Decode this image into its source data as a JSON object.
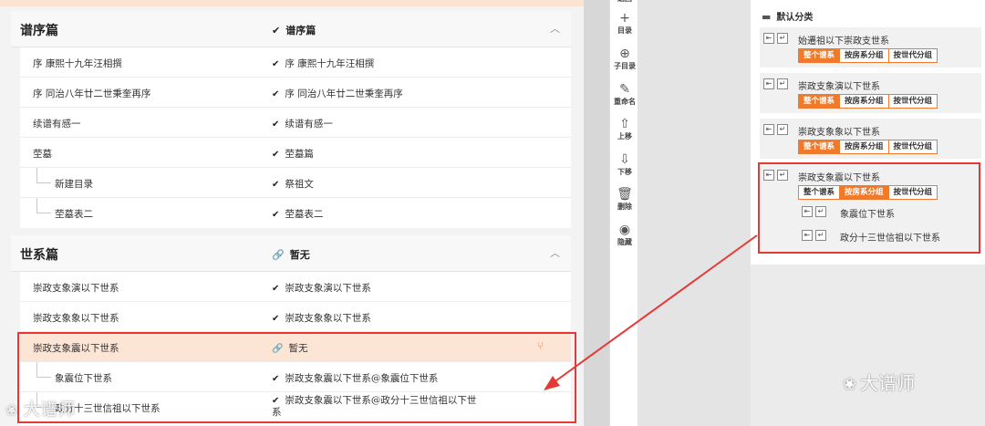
{
  "sections": [
    {
      "title": "谱序篇",
      "link_label": "谱序篇",
      "rows": [
        {
          "name": "序 康熙十九年汪相撰",
          "link": "序 康熙十九年汪相撰",
          "child": false
        },
        {
          "name": "序 同治八年廿二世秉奎再序",
          "link": "序 同治八年廿二世秉奎再序",
          "child": false
        },
        {
          "name": "续谱有感一",
          "link": "续谱有感一",
          "child": false
        },
        {
          "name": "茔墓",
          "link": "茔墓篇",
          "child": false
        },
        {
          "name": "新建目录",
          "link": "祭祖文",
          "child": true
        },
        {
          "name": "茔墓表二",
          "link": "茔墓表二",
          "child": true
        }
      ]
    },
    {
      "title": "世系篇",
      "link_label": "暂无",
      "rows": [
        {
          "name": "崇政支象演以下世系",
          "link": "崇政支象演以下世系",
          "child": false
        },
        {
          "name": "崇政支象象以下世系",
          "link": "崇政支象象以下世系",
          "child": false
        },
        {
          "name": "崇政支象震以下世系",
          "link": "暂无",
          "child": false
        },
        {
          "name": "象震位下世系",
          "link": "崇政支象震以下世系@象震位下世系",
          "child": true
        },
        {
          "name": "政分十三世信祖以下世系",
          "link": "崇政支象震以下世系@政分十三世信祖以下世系",
          "child": true
        }
      ]
    }
  ],
  "toolbar": [
    {
      "label": "返回",
      "icon": "back-icon",
      "glyph": ""
    },
    {
      "label": "目录",
      "icon": "plus-icon",
      "glyph": "+"
    },
    {
      "label": "子目录",
      "icon": "circle-plus-icon",
      "glyph": "⊕"
    },
    {
      "label": "重命名",
      "icon": "pencil-icon",
      "glyph": "✎"
    },
    {
      "label": "上移",
      "icon": "arrow-up-icon",
      "glyph": "⇧"
    },
    {
      "label": "下移",
      "icon": "arrow-down-icon",
      "glyph": "⇩"
    },
    {
      "label": "删除",
      "icon": "trash-icon",
      "glyph": "🗑"
    },
    {
      "label": "隐藏",
      "icon": "eye-off-icon",
      "glyph": "◉"
    }
  ],
  "category": {
    "label": "默认分类",
    "icon": "folder-icon"
  },
  "segments": [
    "整个谱系",
    "按房系分组",
    "按世代分组"
  ],
  "cards": [
    {
      "title": "始遷祖以下崇政支世系",
      "active": 0,
      "subs": []
    },
    {
      "title": "崇政支象演以下世系",
      "active": 0,
      "subs": []
    },
    {
      "title": "崇政支象象以下世系",
      "active": 0,
      "subs": []
    },
    {
      "title": "崇政支象震以下世系",
      "active": 1,
      "subs": [
        "象震位下世系",
        "政分十三世信祖以下世系"
      ]
    }
  ],
  "watermark_right": "大谱师",
  "watermark_left": "大谱师",
  "colors": {
    "accent": "#f07a2c",
    "highlight_row": "#fde5d6",
    "annotation_red": "#e53935"
  }
}
